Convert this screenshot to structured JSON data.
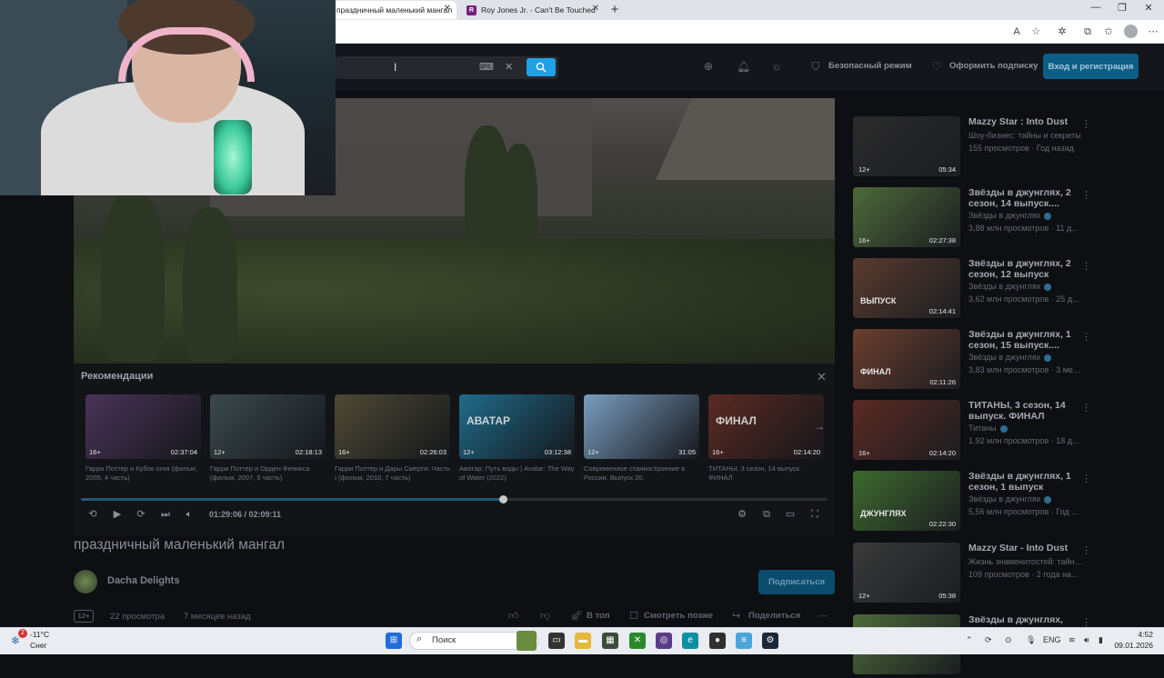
{
  "browser": {
    "tabs": [
      {
        "label": "праздничный маленький мангал"
      },
      {
        "label": "Roy Jones Jr. - Can't Be Touched"
      }
    ],
    "new_tab_symbol": "+"
  },
  "header": {
    "safe_mode": "Безопасный режим",
    "subscribe_offer": "Оформить подписку",
    "login": "Вход и регистрация"
  },
  "player": {
    "recommendations_title": "Рекомендации",
    "time": "01:29:06 / 02:09:11",
    "progress": 0.726,
    "recommendations": [
      {
        "age": "16+",
        "duration": "02:37:04",
        "caption": "Гарри Поттер и Кубок огня (фильм, 2005, 4 часть)",
        "color": "#4a3358"
      },
      {
        "age": "12+",
        "duration": "02:18:13",
        "caption": "Гарри Поттер и Орден Феникса (фильм, 2007, 5 часть)",
        "color": "#3b4a4a"
      },
      {
        "age": "16+",
        "duration": "02:26:03",
        "caption": "Гарри Поттер и Дары Смерти: Часть I (фильм, 2010, 7 часть)",
        "color": "#4e4a35"
      },
      {
        "age": "12+",
        "duration": "03:12:38",
        "caption": "Аватар: Путь воды | Avatar: The Way of Water (2022)",
        "color": "#1f6c8a",
        "thumb_text": "АВАТАР"
      },
      {
        "age": "12+",
        "duration": "31:05",
        "caption": "Современное станкостроение в России. Выпуск 20.",
        "color": "#7a9dc0"
      },
      {
        "age": "16+",
        "duration": "02:14:20",
        "caption": "ТИТАНЫ, 3 сезон, 14 выпуск. ФИНАЛ",
        "color": "#5b2a22",
        "thumb_text": "ФИНАЛ"
      }
    ]
  },
  "video": {
    "title": "праздничный маленький мангал",
    "channel": "Dacha Delights",
    "subscribe": "Подписаться",
    "age": "12+",
    "views": "22 просмотра",
    "posted": "7 месяцев назад",
    "actions": {
      "to_top": "В топ",
      "watch_later": "Смотреть позже",
      "share": "Поделиться"
    }
  },
  "sidebar": [
    {
      "title": "Mazzy Star : Into Dust",
      "channel": "Шоу-бизнес: тайны и секреты",
      "views": "155 просмотров · Год назад",
      "age": "12+",
      "duration": "05:34",
      "color": "#2b2b2b",
      "verified": false
    },
    {
      "title": "Звёзды в джунглях, 2 сезон, 14 выпуск....",
      "channel": "Звёзды в джунглях",
      "views": "3,88 млн просмотров · 11 д...",
      "age": "16+",
      "duration": "02:27:38",
      "color": "#4e6a3a",
      "verified": true
    },
    {
      "title": "Звёзды в джунглях, 2 сезон, 12 выпуск",
      "channel": "Звёзды в джунглях",
      "views": "3,62 млн просмотров · 25 д...",
      "age": "",
      "duration": "02:14:41",
      "color": "#5a3b2e",
      "verified": true,
      "thumb_text": "ВЫПУСК"
    },
    {
      "title": "Звёзды в джунглях, 1 сезон, 15 выпуск....",
      "channel": "Звёзды в джунглях",
      "views": "3,83 млн просмотров · 3 ме...",
      "age": "",
      "duration": "02:11:26",
      "color": "#6b3e2d",
      "verified": true,
      "thumb_text": "ФИНАЛ"
    },
    {
      "title": "ТИТАНЫ, 3 сезон, 14 выпуск. ФИНАЛ",
      "channel": "Титаны",
      "views": "1,92 млн просмотров · 18 д...",
      "age": "16+",
      "duration": "02:14:20",
      "color": "#5b2a22",
      "verified": true
    },
    {
      "title": "Звёзды в джунглях, 1 сезон, 1 выпуск",
      "channel": "Звёзды в джунглях",
      "views": "5,56 млн просмотров · Год ...",
      "age": "",
      "duration": "02:22:30",
      "color": "#3e6a2e",
      "verified": true,
      "thumb_text": "ДЖУНГЛЯХ"
    },
    {
      "title": "Mazzy Star - Into Dust",
      "channel": "Жизнь знаменитостей: тайн...",
      "views": "109 просмотров · 2 года на...",
      "age": "12+",
      "duration": "05:38",
      "color": "#3a3a3a",
      "verified": false
    },
    {
      "title": "Звёзды в джунглях,",
      "channel": "",
      "views": "",
      "age": "",
      "duration": "",
      "color": "#4e6a3a",
      "verified": false
    }
  ],
  "taskbar": {
    "notifications": "2",
    "temperature": "-11°C",
    "weather": "Снег",
    "search": "Поиск",
    "language": "ENG",
    "time": "4:52",
    "date": "09.01.2026"
  }
}
